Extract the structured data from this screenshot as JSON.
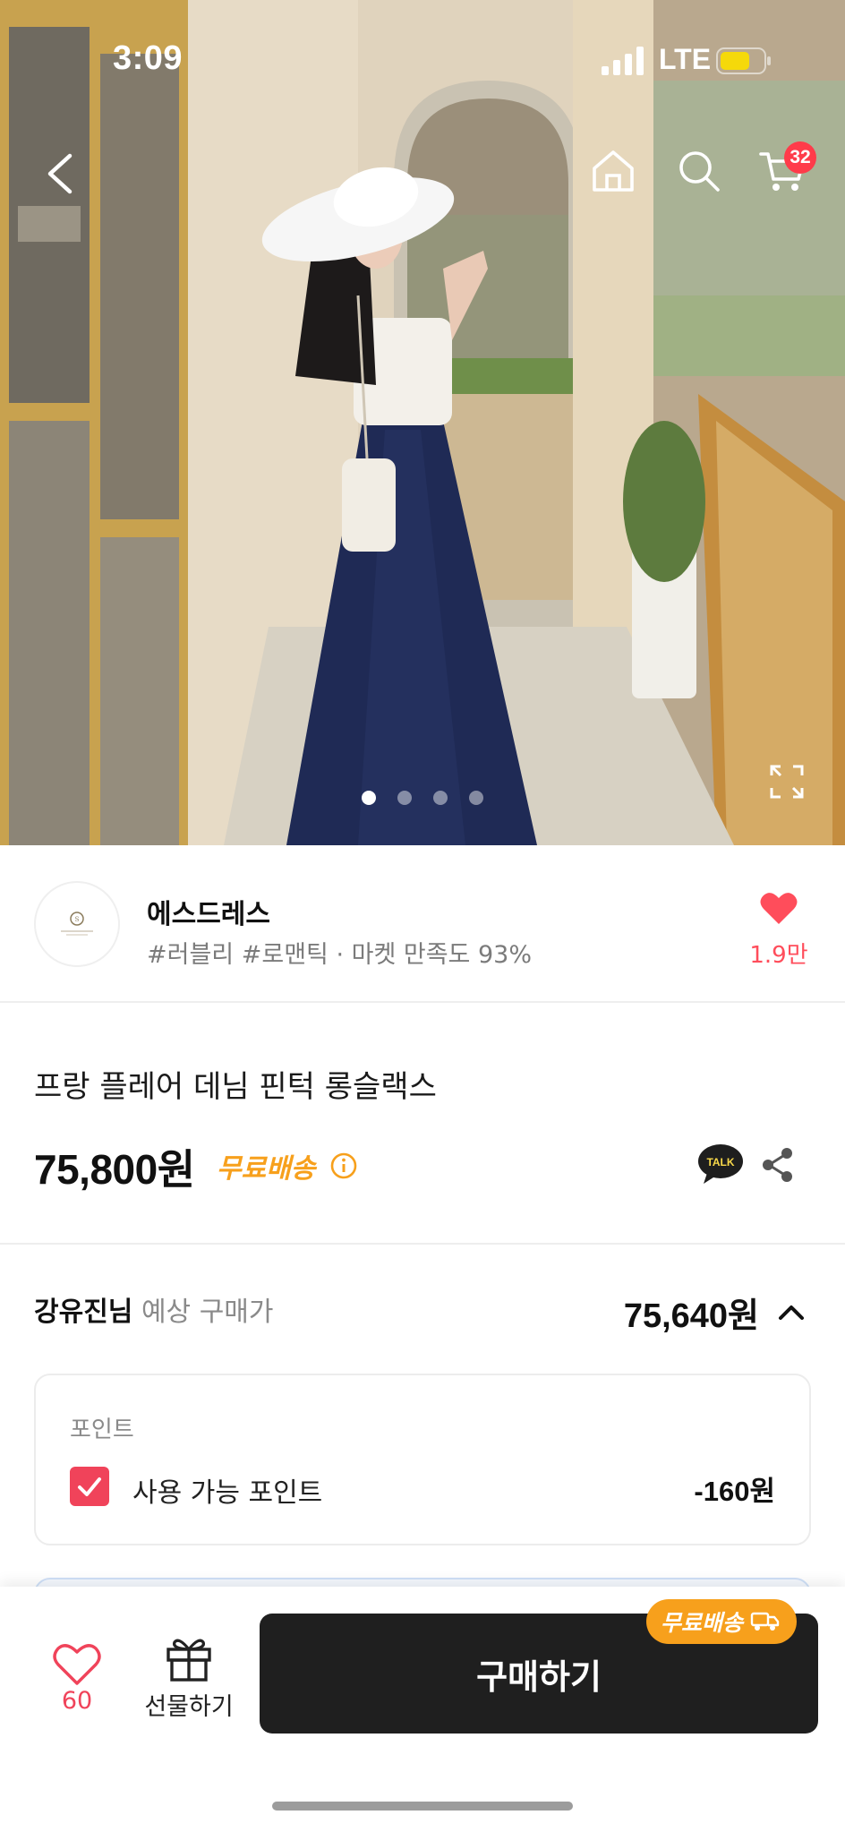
{
  "status_bar": {
    "time": "3:09",
    "network": "LTE",
    "battery_color": "#f5d90a"
  },
  "top_nav": {
    "back_icon": "chevron-left-icon",
    "home_icon": "home-icon",
    "search_icon": "search-icon",
    "cart_icon": "cart-icon",
    "cart_badge": "32"
  },
  "gallery": {
    "dot_count": 4,
    "active_index": 0,
    "expand_icon": "expand-icon"
  },
  "seller": {
    "name": "에스드레스",
    "tags": "#러블리 #로맨틱 · 마켓 만족도 93%",
    "likes": "1.9만"
  },
  "product": {
    "title": "프랑 플레어 데님 핀턱 롱슬랙스",
    "price": "75,800원",
    "shipping_label": "무료배송",
    "talk_label": "TALK"
  },
  "expected_price": {
    "user": "강유진님",
    "label": "예상 구매가",
    "value": "75,640원"
  },
  "points": {
    "title": "포인트",
    "label": "사용 가능 포인트",
    "value": "-160원",
    "checked": true
  },
  "bottom_bar": {
    "wish_count": "60",
    "gift_label": "선물하기",
    "buy_label": "구매하기",
    "ship_tag": "무료배송"
  },
  "colors": {
    "accent_red": "#f0435a",
    "accent_orange": "#f7a01c",
    "buy_button": "#1f1f1f"
  }
}
